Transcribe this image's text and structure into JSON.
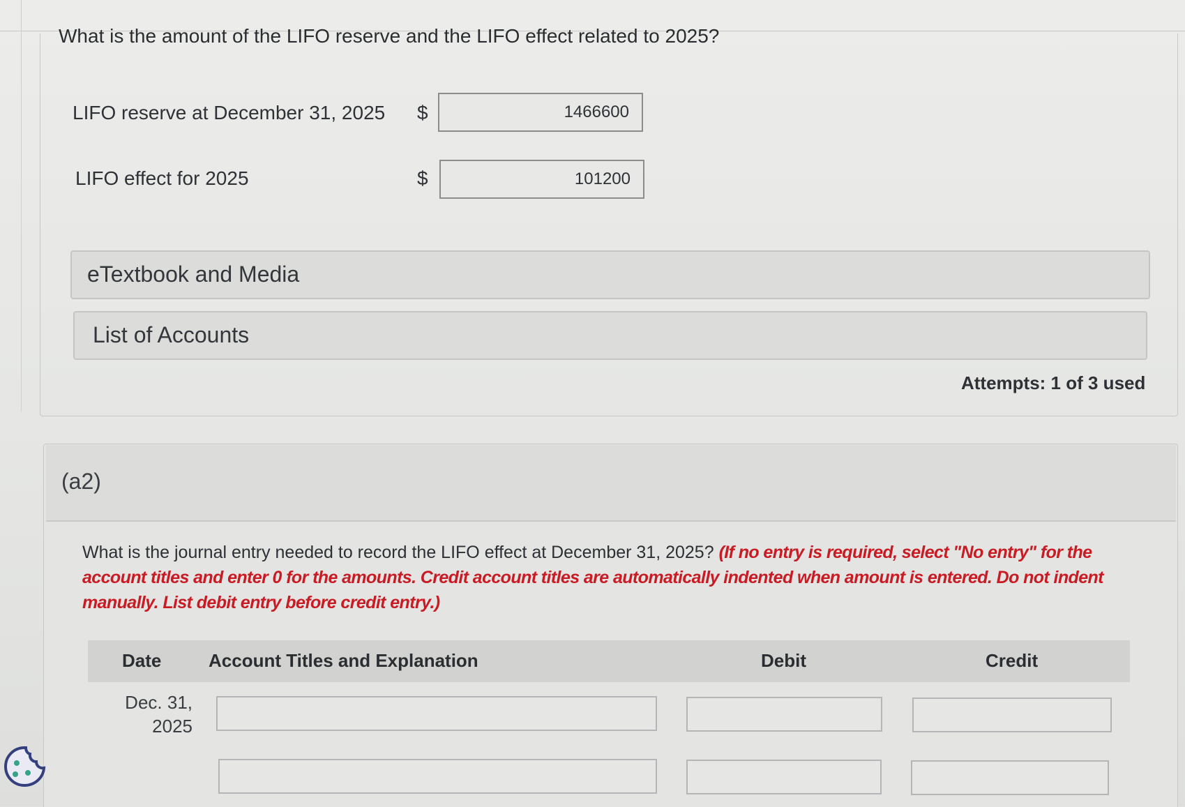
{
  "question": "What is the amount of the LIFO reserve and the LIFO effect related to 2025?",
  "rows": [
    {
      "label": "LIFO reserve at December 31, 2025",
      "currency": "$",
      "value": "1466600"
    },
    {
      "label": "LIFO effect for 2025",
      "currency": "$",
      "value": "101200"
    }
  ],
  "resources": {
    "etextbook": "eTextbook and Media",
    "accounts": "List of Accounts"
  },
  "attempts": "Attempts: 1 of 3 used",
  "part2": {
    "label": "(a2)",
    "question_plain": "What is the journal entry needed to record the LIFO effect at December 31, 2025? ",
    "question_instruction": "(If no entry is required, select \"No entry\" for the account titles and enter 0 for the amounts. Credit account titles are automatically indented when amount is entered. Do not indent manually. List debit entry before credit entry.)",
    "table": {
      "headers": {
        "date": "Date",
        "account": "Account Titles and Explanation",
        "debit": "Debit",
        "credit": "Credit"
      },
      "date_line1": "Dec. 31,",
      "date_line2": "2025"
    }
  },
  "icons": {
    "cookie": "cookie-icon"
  }
}
